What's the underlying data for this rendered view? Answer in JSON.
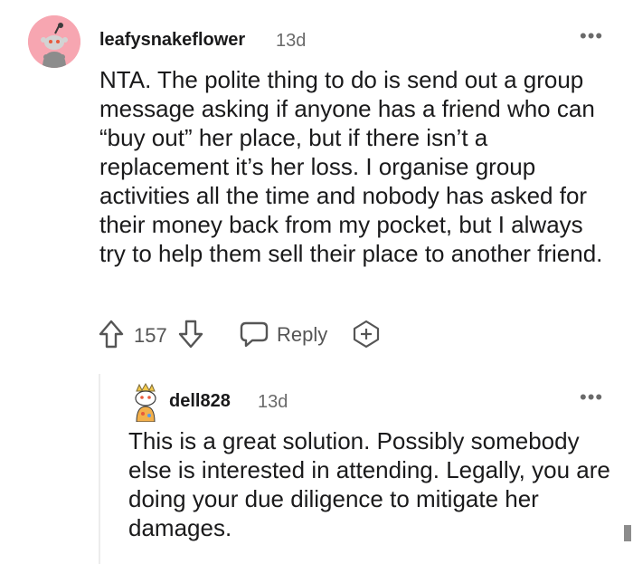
{
  "comment": {
    "author": "leafysnakeflower",
    "time": "13d",
    "more_label": "•••",
    "body": "NTA. The polite thing to do is send out a group message asking if anyone has a friend who can “buy out” her place, but if there isn’t a replacement it’s her loss. I organise group activities all the time and nobody has asked for their money back from my pocket, but I always try to help them sell their place to another friend.",
    "score": "157",
    "reply_label": "Reply",
    "avatar_color": "#f7a6b1"
  },
  "reply": {
    "author": "dell828",
    "time": "13d",
    "more_label": "•••",
    "body": "This is a great solution. Possibly somebody else is interested in attending. Legally, you are doing your due diligence to mitigate her damages."
  },
  "icons": {
    "upvote": "arrow-up-icon",
    "downvote": "arrow-down-icon",
    "reply": "speech-bubble-icon",
    "award": "add-award-icon",
    "more": "more-options-icon"
  }
}
